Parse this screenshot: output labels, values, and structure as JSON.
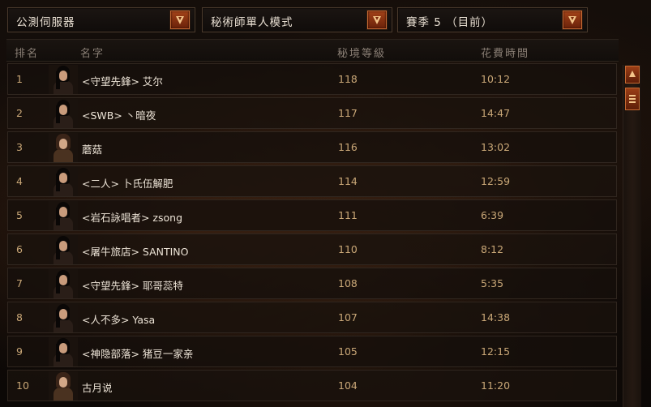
{
  "filters": {
    "server": "公測伺服器",
    "mode": "秘術師單人模式",
    "season": "賽季 5 （目前）"
  },
  "columns": {
    "rank": "排名",
    "name": "名字",
    "level": "秘境等級",
    "time": "花費時間"
  },
  "rows": [
    {
      "rank": "1",
      "name": "<守望先鋒> 艾尔",
      "level": "118",
      "time": "10:12",
      "portrait": "female-dark-hair"
    },
    {
      "rank": "2",
      "name": "<SWB> 丶暗夜",
      "level": "117",
      "time": "14:47",
      "portrait": "female-dark-hair"
    },
    {
      "rank": "3",
      "name": "蘑菇",
      "level": "116",
      "time": "13:02",
      "portrait": "male-brown-hair"
    },
    {
      "rank": "4",
      "name": "<二人> 卜氏伍解肥",
      "level": "114",
      "time": "12:59",
      "portrait": "female-dark-hair"
    },
    {
      "rank": "5",
      "name": "<岩石詠唱者> zsong",
      "level": "111",
      "time": "6:39",
      "portrait": "female-dark-hair"
    },
    {
      "rank": "6",
      "name": "<屠牛旅店> SANTINO",
      "level": "110",
      "time": "8:12",
      "portrait": "female-dark-hair"
    },
    {
      "rank": "7",
      "name": "<守望先鋒> 耶哥蕊特",
      "level": "108",
      "time": "5:35",
      "portrait": "female-dark-hair"
    },
    {
      "rank": "8",
      "name": "<人不多> Yasa",
      "level": "107",
      "time": "14:38",
      "portrait": "female-dark-hair"
    },
    {
      "rank": "9",
      "name": "<神隐部落> 猪豆一家亲",
      "level": "105",
      "time": "12:15",
      "portrait": "female-dark-hair"
    },
    {
      "rank": "10",
      "name": "古月说",
      "level": "104",
      "time": "11:20",
      "portrait": "male-brown-hair"
    }
  ],
  "icons": {
    "dropdown": "chevron-down-icon",
    "scroll_up": "arrow-up-icon",
    "scroll_thumb": "grip-icon"
  },
  "colors": {
    "accent": "#a24218",
    "accent_border": "#c76a34",
    "value_text": "#c9a777",
    "name_text": "#ece3d6"
  }
}
